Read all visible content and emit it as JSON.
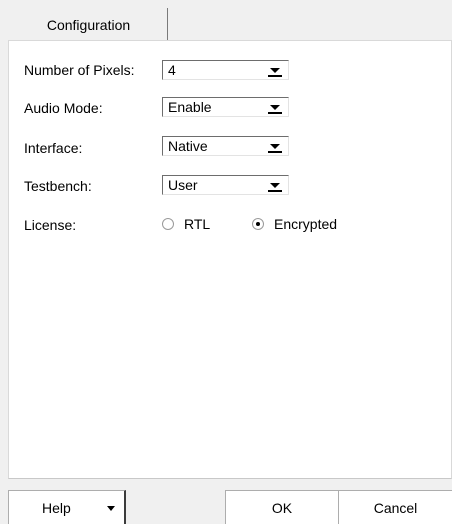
{
  "tabs": [
    {
      "label": "Configuration"
    }
  ],
  "fields": {
    "pixels": {
      "label": "Number of Pixels:",
      "value": "4"
    },
    "audio": {
      "label": "Audio Mode:",
      "value": "Enable"
    },
    "interface": {
      "label": "Interface:",
      "value": "Native"
    },
    "testbench": {
      "label": "Testbench:",
      "value": "User"
    },
    "license": {
      "label": "License:",
      "options": [
        {
          "label": "RTL",
          "checked": false
        },
        {
          "label": "Encrypted",
          "checked": true
        }
      ]
    }
  },
  "buttons": {
    "help": "Help",
    "ok": "OK",
    "cancel": "Cancel"
  },
  "icons": {
    "combo_arrow": "chevron-down-icon",
    "help_arrow": "caret-down-icon",
    "radio": "radio-icon"
  }
}
